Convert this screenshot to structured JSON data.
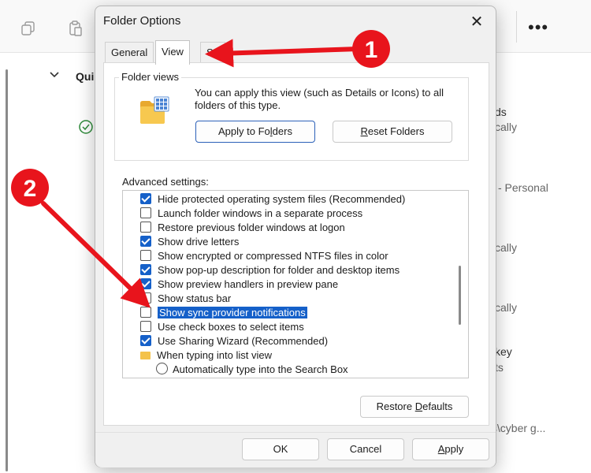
{
  "background_window": {
    "toolbar_icons": [
      "copy-icon",
      "paste-icon"
    ],
    "more_label": "•••",
    "nav_label": "Qui",
    "right_fragments": [
      {
        "text": "ds"
      },
      {
        "text": "cally"
      },
      {
        "text": "- Personal"
      },
      {
        "text": "cally"
      },
      {
        "text": "cally"
      },
      {
        "text": "key"
      },
      {
        "text": "ts"
      },
      {
        "text": "ts\\cyber g..."
      }
    ]
  },
  "dialog": {
    "title": "Folder Options",
    "close_label": "✕",
    "tabs": [
      {
        "label": "General",
        "active": false
      },
      {
        "label": "View",
        "active": true
      },
      {
        "label": "Se",
        "active": false
      }
    ],
    "folder_views": {
      "label": "Folder views",
      "description": "You can apply this view (such as Details or Icons) to all folders of this type.",
      "apply_button": {
        "before": "Apply to Fo",
        "accel": "l",
        "after": "ders"
      },
      "reset_button": {
        "before": "",
        "accel": "R",
        "after": "eset Folders"
      }
    },
    "advanced": {
      "label": "Advanced settings:",
      "items": [
        {
          "type": "checkbox",
          "checked": true,
          "label": "Hide protected operating system files (Recommended)"
        },
        {
          "type": "checkbox",
          "checked": false,
          "label": "Launch folder windows in a separate process"
        },
        {
          "type": "checkbox",
          "checked": false,
          "label": "Restore previous folder windows at logon"
        },
        {
          "type": "checkbox",
          "checked": true,
          "label": "Show drive letters"
        },
        {
          "type": "checkbox",
          "checked": false,
          "label": "Show encrypted or compressed NTFS files in color"
        },
        {
          "type": "checkbox",
          "checked": true,
          "label": "Show pop-up description for folder and desktop items"
        },
        {
          "type": "checkbox",
          "checked": true,
          "label": "Show preview handlers in preview pane"
        },
        {
          "type": "checkbox",
          "checked": false,
          "label": "Show status bar"
        },
        {
          "type": "checkbox",
          "checked": false,
          "selected": true,
          "label": "Show sync provider notifications"
        },
        {
          "type": "checkbox",
          "checked": false,
          "label": "Use check boxes to select items"
        },
        {
          "type": "checkbox",
          "checked": true,
          "label": "Use Sharing Wizard (Recommended)"
        },
        {
          "type": "folder",
          "label": "When typing into list view"
        },
        {
          "type": "radio",
          "checked": false,
          "label": "Automatically type into the Search Box"
        }
      ]
    },
    "restore_defaults": {
      "before": "Restore ",
      "accel": "D",
      "after": "efaults"
    },
    "footer_buttons": {
      "ok": "OK",
      "cancel": "Cancel",
      "apply": {
        "before": "",
        "accel": "A",
        "after": "pply"
      }
    }
  },
  "annotations": {
    "badge_1": "1",
    "badge_2": "2",
    "color": "#e8141c"
  }
}
